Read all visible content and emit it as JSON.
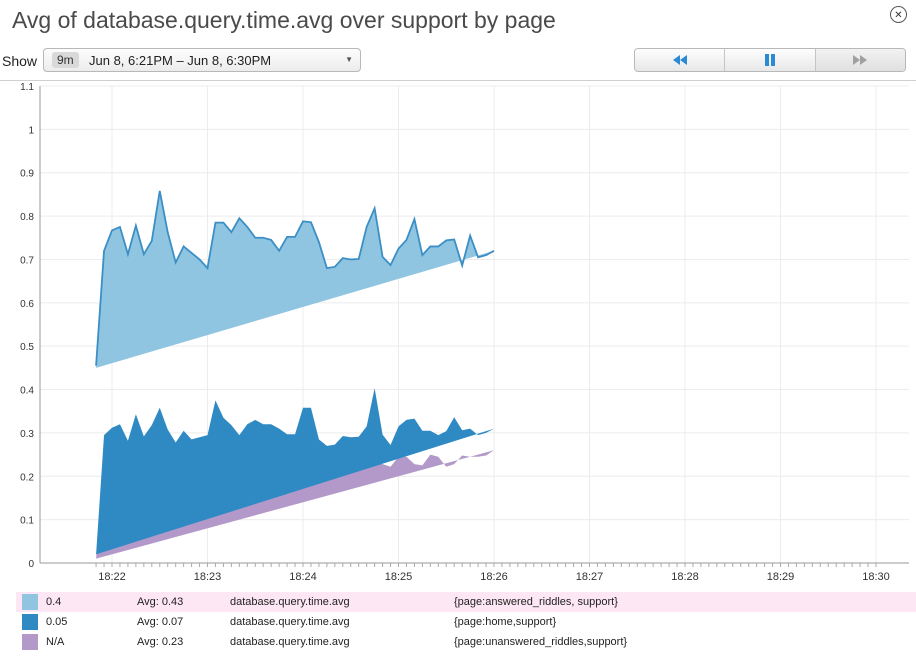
{
  "window": {
    "title": "Avg of database.query.time.avg over support by page"
  },
  "controls": {
    "show_label": "Show",
    "range_badge": "9m",
    "range_text": "Jun 8, 6:21PM – Jun 8, 6:30PM",
    "playback": [
      {
        "name": "rewind-icon",
        "active": false
      },
      {
        "name": "pause-icon",
        "active": true
      },
      {
        "name": "fast-forward-icon",
        "active": false
      }
    ]
  },
  "colors": {
    "answered": "#90c5e1",
    "answered_line": "#3b8fc5",
    "home": "#2f8ac4",
    "unanswered": "#b399c9",
    "icon_active": "#2a8ad3",
    "icon_inactive": "#a0a0a0"
  },
  "chart_data": {
    "type": "area",
    "stacked": true,
    "xlabel": "",
    "ylabel": "",
    "x_ticks": [
      "18:22",
      "18:23",
      "18:24",
      "18:25",
      "18:26",
      "18:27",
      "18:28",
      "18:29",
      "18:30"
    ],
    "x_tick_values": [
      1,
      2,
      3,
      4,
      5,
      6,
      7,
      8,
      9
    ],
    "xlim": [
      0.8,
      9.2
    ],
    "ylim": [
      0,
      1.1
    ],
    "y_ticks": [
      0,
      0.1,
      0.2,
      0.3,
      0.4,
      0.5,
      0.6,
      0.7,
      0.8,
      0.9,
      1,
      1.1
    ],
    "grid": true,
    "x": [
      0.8333,
      0.9167,
      1.0,
      1.0833,
      1.1667,
      1.25,
      1.3333,
      1.4167,
      1.5,
      1.5833,
      1.6667,
      1.75,
      1.8333,
      1.9167,
      2.0,
      2.0833,
      2.1667,
      2.25,
      2.3333,
      2.4167,
      2.5,
      2.5833,
      2.6667,
      2.75,
      2.8333,
      2.9167,
      3.0,
      3.0833,
      3.1667,
      3.25,
      3.3333,
      3.4167,
      3.5,
      3.5833,
      3.6667,
      3.75,
      3.8333,
      3.9167,
      4.0,
      4.0833,
      4.1667,
      4.25,
      4.3333,
      4.4167,
      4.5,
      4.5833,
      4.6667,
      4.75,
      4.8333,
      4.9167,
      5.0,
      5.0833,
      5.1667,
      5.25,
      5.3333,
      5.4167,
      5.5,
      5.5833,
      5.6667,
      5.75,
      5.8333,
      5.9167,
      6.0,
      6.0833,
      6.1667,
      6.25,
      6.3333,
      6.4167,
      6.5,
      6.5833,
      6.6667,
      6.75,
      6.8333,
      6.9167,
      7.0,
      7.0833,
      7.1667,
      7.25,
      7.3333,
      7.4167,
      7.5,
      7.5833,
      7.6667,
      7.75,
      7.8333,
      7.9167,
      8.0,
      8.0833,
      8.1667,
      8.25,
      8.3333,
      8.4167,
      8.5,
      8.5833,
      8.6667,
      8.75,
      8.8333,
      8.9167,
      9.0
    ],
    "series": [
      {
        "name": "{page:unanswered_riddles,support}",
        "color": "#b399c9",
        "values": [
          0.01,
          0.225,
          0.222,
          0.25,
          0.232,
          0.268,
          0.242,
          0.238,
          0.268,
          0.248,
          0.228,
          0.225,
          0.245,
          0.22,
          0.205,
          0.225,
          0.245,
          0.248,
          0.225,
          0.25,
          0.245,
          0.252,
          0.245,
          0.248,
          0.225,
          0.222,
          0.248,
          0.248,
          0.225,
          0.222,
          0.225,
          0.248,
          0.22,
          0.248,
          0.245,
          0.248,
          0.228,
          0.222,
          0.245,
          0.245,
          0.228,
          0.225,
          0.25,
          0.245,
          0.222,
          0.228,
          0.248,
          0.245,
          0.245,
          0.248,
          0.26
        ]
      },
      {
        "name": "{page:home,support}",
        "color": "#2f8ac4",
        "values": [
          0.01,
          0.07,
          0.09,
          0.07,
          0.05,
          0.075,
          0.05,
          0.08,
          0.09,
          0.06,
          0.05,
          0.08,
          0.04,
          0.07,
          0.09,
          0.15,
          0.09,
          0.07,
          0.07,
          0.07,
          0.085,
          0.068,
          0.075,
          0.062,
          0.072,
          0.075,
          0.11,
          0.11,
          0.06,
          0.048,
          0.048,
          0.045,
          0.07,
          0.043,
          0.07,
          0.155,
          0.068,
          0.05,
          0.07,
          0.085,
          0.105,
          0.08,
          0.055,
          0.05,
          0.082,
          0.108,
          0.058,
          0.065,
          0.05,
          0.052,
          0.05
        ]
      },
      {
        "name": "{page:answered_riddles, support}",
        "color": "#90c5e1",
        "values": [
          0.43,
          0.425,
          0.455,
          0.455,
          0.43,
          0.435,
          0.42,
          0.425,
          0.5,
          0.455,
          0.415,
          0.425,
          0.43,
          0.41,
          0.385,
          0.41,
          0.45,
          0.445,
          0.5,
          0.455,
          0.42,
          0.43,
          0.425,
          0.41,
          0.455,
          0.455,
          0.43,
          0.428,
          0.455,
          0.41,
          0.41,
          0.41,
          0.41,
          0.41,
          0.46,
          0.415,
          0.41,
          0.415,
          0.41,
          0.415,
          0.46,
          0.405,
          0.425,
          0.435,
          0.44,
          0.41,
          0.38,
          0.445,
          0.41,
          0.41,
          0.41
        ]
      }
    ],
    "totals_line": [
      0.455,
      0.72,
      0.767,
      0.775,
      0.712,
      0.778,
      0.712,
      0.743,
      0.858,
      0.763,
      0.693,
      0.73,
      0.715,
      0.7,
      0.68,
      0.785,
      0.785,
      0.763,
      0.795,
      0.775,
      0.75,
      0.75,
      0.745,
      0.72,
      0.752,
      0.752,
      0.788,
      0.786,
      0.74,
      0.68,
      0.683,
      0.703,
      0.7,
      0.701,
      0.775,
      0.818,
      0.706,
      0.687,
      0.725,
      0.745,
      0.793,
      0.71,
      0.73,
      0.73,
      0.744,
      0.746,
      0.686,
      0.755,
      0.705,
      0.71,
      0.72
    ]
  },
  "legend": [
    {
      "value": "0.4",
      "avg": "Avg: 0.43",
      "metric": "database.query.time.avg",
      "scope": "{page:answered_riddles, support}",
      "color": "#90c5e1",
      "highlight": true
    },
    {
      "value": "0.05",
      "avg": "Avg: 0.07",
      "metric": "database.query.time.avg",
      "scope": "{page:home,support}",
      "color": "#2f8ac4",
      "highlight": false
    },
    {
      "value": "N/A",
      "avg": "Avg: 0.23",
      "metric": "database.query.time.avg",
      "scope": "{page:unanswered_riddles,support}",
      "color": "#b399c9",
      "highlight": false
    }
  ]
}
